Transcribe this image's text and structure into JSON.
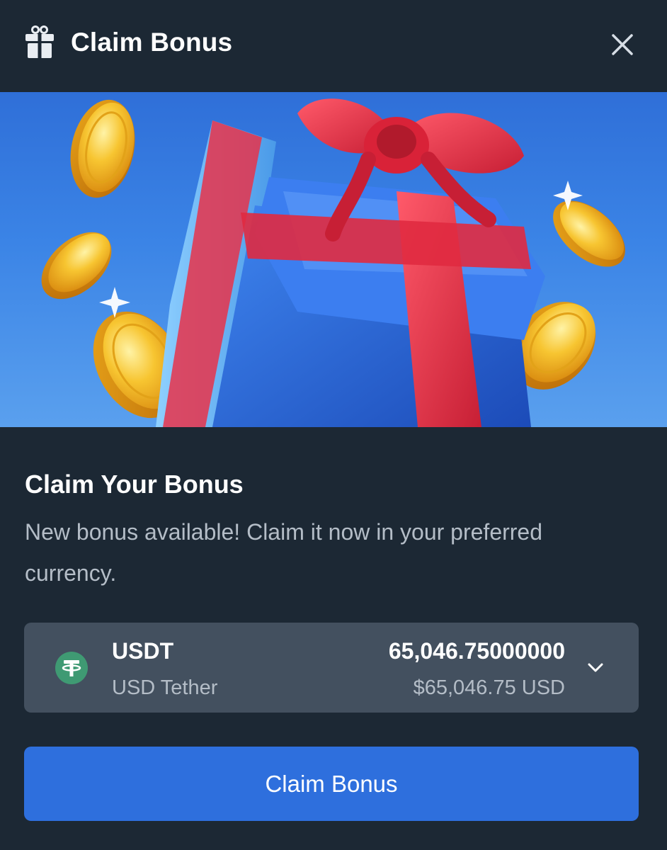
{
  "header": {
    "title": "Claim Bonus",
    "icon": "gift-icon",
    "close_icon": "close-icon"
  },
  "banner": {
    "illustration": "gift-box-with-coins"
  },
  "content": {
    "title": "Claim Your Bonus",
    "description": "New bonus available! Claim it now in your preferred currency."
  },
  "currency": {
    "code": "USDT",
    "name": "USD Tether",
    "amount": "65,046.75000000",
    "usd_value": "$65,046.75 USD",
    "icon": "tether-icon",
    "expand_icon": "chevron-down-icon"
  },
  "actions": {
    "claim_label": "Claim Bonus"
  },
  "colors": {
    "background": "#1c2834",
    "select_background": "#43505f",
    "button": "#2e6fdd",
    "tether": "#3f9a73",
    "muted_text": "#b4bdc7"
  }
}
